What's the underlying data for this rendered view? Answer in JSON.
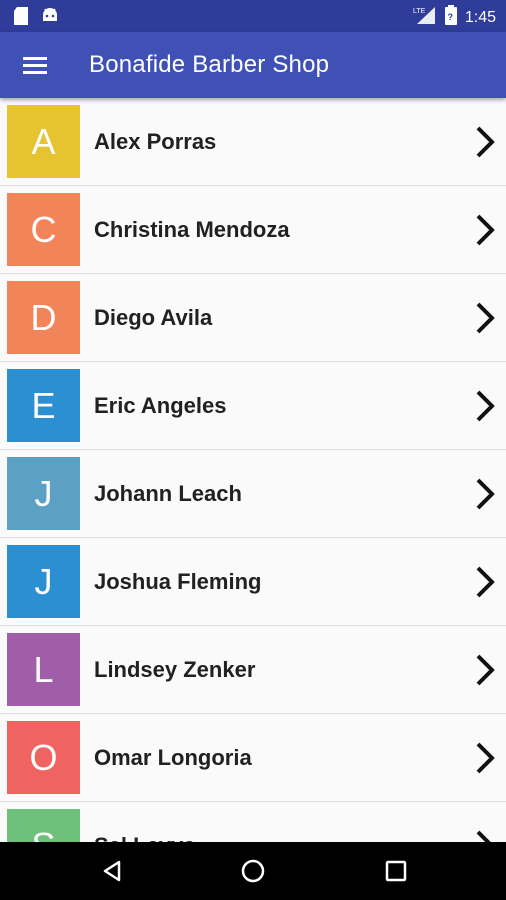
{
  "status_bar": {
    "time": "1:45",
    "network": "LTE",
    "icons": [
      "sd-card-icon",
      "android-icon",
      "lte-signal-icon",
      "battery-icon"
    ]
  },
  "toolbar": {
    "title": "Bonafide Barber Shop",
    "menu_icon": "hamburger-menu-icon"
  },
  "barbers": [
    {
      "letter": "A",
      "name": "Alex Porras",
      "color": "#e5c331"
    },
    {
      "letter": "C",
      "name": "Christina Mendoza",
      "color": "#f2845a"
    },
    {
      "letter": "D",
      "name": "Diego Avila",
      "color": "#f2845a"
    },
    {
      "letter": "E",
      "name": "Eric Angeles",
      "color": "#2b8fd1"
    },
    {
      "letter": "J",
      "name": "Johann Leach",
      "color": "#5ca1c4"
    },
    {
      "letter": "J",
      "name": "Joshua Fleming",
      "color": "#2b8fd1"
    },
    {
      "letter": "L",
      "name": "Lindsey Zenker",
      "color": "#a05da8"
    },
    {
      "letter": "O",
      "name": "Omar Longoria",
      "color": "#ef6460"
    },
    {
      "letter": "S",
      "name": "Sal Leyva",
      "color": "#6fc07a"
    }
  ],
  "nav_bar": {
    "buttons": [
      "back-icon",
      "home-icon",
      "recents-icon"
    ]
  }
}
